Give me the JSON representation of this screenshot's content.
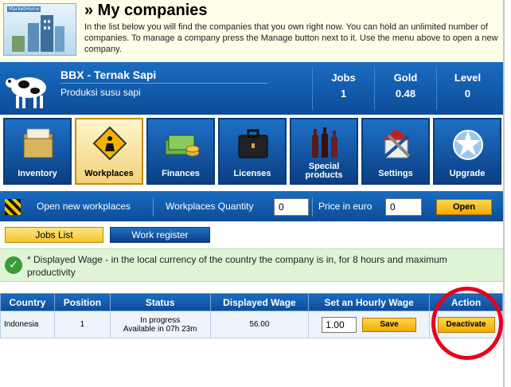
{
  "header": {
    "title": "» My companies",
    "intro": "In the list below you will find the companies that you own right now. You can hold an unlimited number of companies. To manage a company press the Manage button next to it. Use the menu above to open a new company.",
    "logo_text": "MarketHome"
  },
  "company": {
    "name": "BBX - Ternak Sapi",
    "description": "Produksi susu sapi",
    "stats": [
      {
        "label": "Jobs",
        "value": "1"
      },
      {
        "label": "Gold",
        "value": "0.48"
      },
      {
        "label": "Level",
        "value": "0"
      }
    ]
  },
  "nav": {
    "items": [
      {
        "label": "Inventory",
        "icon": "folder-icon",
        "active": false
      },
      {
        "label": "Workplaces",
        "icon": "construction-sign-icon",
        "active": true
      },
      {
        "label": "Finances",
        "icon": "money-icon",
        "active": false
      },
      {
        "label": "Licenses",
        "icon": "briefcase-icon",
        "active": false
      },
      {
        "label": "Special products",
        "icon": "bottles-icon",
        "active": false
      },
      {
        "label": "Settings",
        "icon": "tools-icon",
        "active": false
      },
      {
        "label": "Upgrade",
        "icon": "star-upgrade-icon",
        "active": false
      }
    ]
  },
  "workplaces": {
    "open_label": "Open new workplaces",
    "quantity_label": "Workplaces Quantity",
    "quantity_value": "0",
    "price_label": "Price in euro",
    "price_value": "0",
    "open_button": "Open"
  },
  "tabs": {
    "jobs_list": "Jobs List",
    "work_register": "Work register"
  },
  "notice": {
    "text": "* Displayed Wage - in the local currency of the country the company is in, for 8 hours and maximum productivity"
  },
  "table": {
    "headers": [
      "Country",
      "Position",
      "Status",
      "Displayed Wage",
      "Set an Hourly Wage",
      "Action"
    ],
    "rows": [
      {
        "country": "Indonesia",
        "position": "1",
        "status_line1": "In progress",
        "status_line2": "Available in 07h 23m",
        "wage": "56.00",
        "hourly_value": "1.00",
        "save_label": "Save",
        "action_label": "Deactivate"
      }
    ]
  },
  "colors": {
    "accent_blue": "#0d4c98",
    "button_yellow": "#f2a900",
    "annotation_red": "#e8001c",
    "notice_green": "#dff5d6"
  }
}
